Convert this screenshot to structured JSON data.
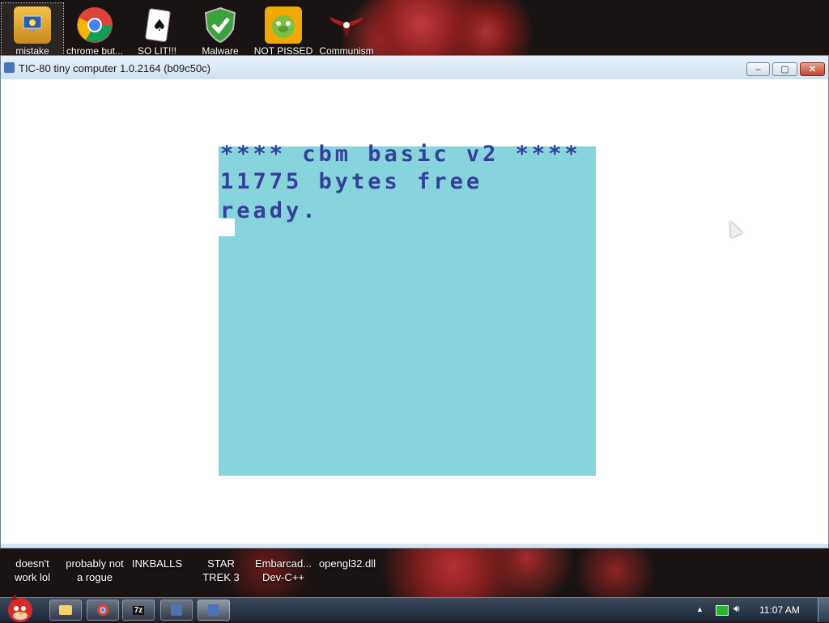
{
  "desktop_top_icons": [
    {
      "label": "mistake",
      "icon": "computer-icon"
    },
    {
      "label": "chrome but...",
      "icon": "chrome-icon"
    },
    {
      "label": "SO LIT!!!",
      "icon": "solitaire-icon"
    },
    {
      "label": "Malware",
      "icon": "shield-icon"
    },
    {
      "label": "NOT PISSED",
      "icon": "bad-piggies-icon"
    },
    {
      "label": "Communism",
      "icon": "emblem-icon"
    }
  ],
  "desktop_bottom_icons": [
    {
      "label": "doesn't work lol"
    },
    {
      "label": "probably not a rogue"
    },
    {
      "label": "INKBALLS"
    },
    {
      "label": "STAR TREK 3"
    },
    {
      "label": "Embarcad... Dev-C++"
    },
    {
      "label": "opengl32.dll"
    }
  ],
  "window": {
    "title": "TIC-80 tiny computer 1.0.2164 (b09c50c)",
    "minimize": "‒",
    "maximize": "▢",
    "close": "✕"
  },
  "screen": {
    "line1": "**** cbm basic v2 ****",
    "line2": "11775 bytes free",
    "line3": "ready.",
    "bg_color": "#87d4dc",
    "text_color": "#35409a"
  },
  "taskbar": {
    "clock": "11:07 AM",
    "tray_arrow": "▲",
    "buttons": [
      "folder-icon",
      "chrome-icon",
      "7zip-icon",
      "tic80-icon",
      "tic80-icon"
    ],
    "zip_label": "7z"
  }
}
